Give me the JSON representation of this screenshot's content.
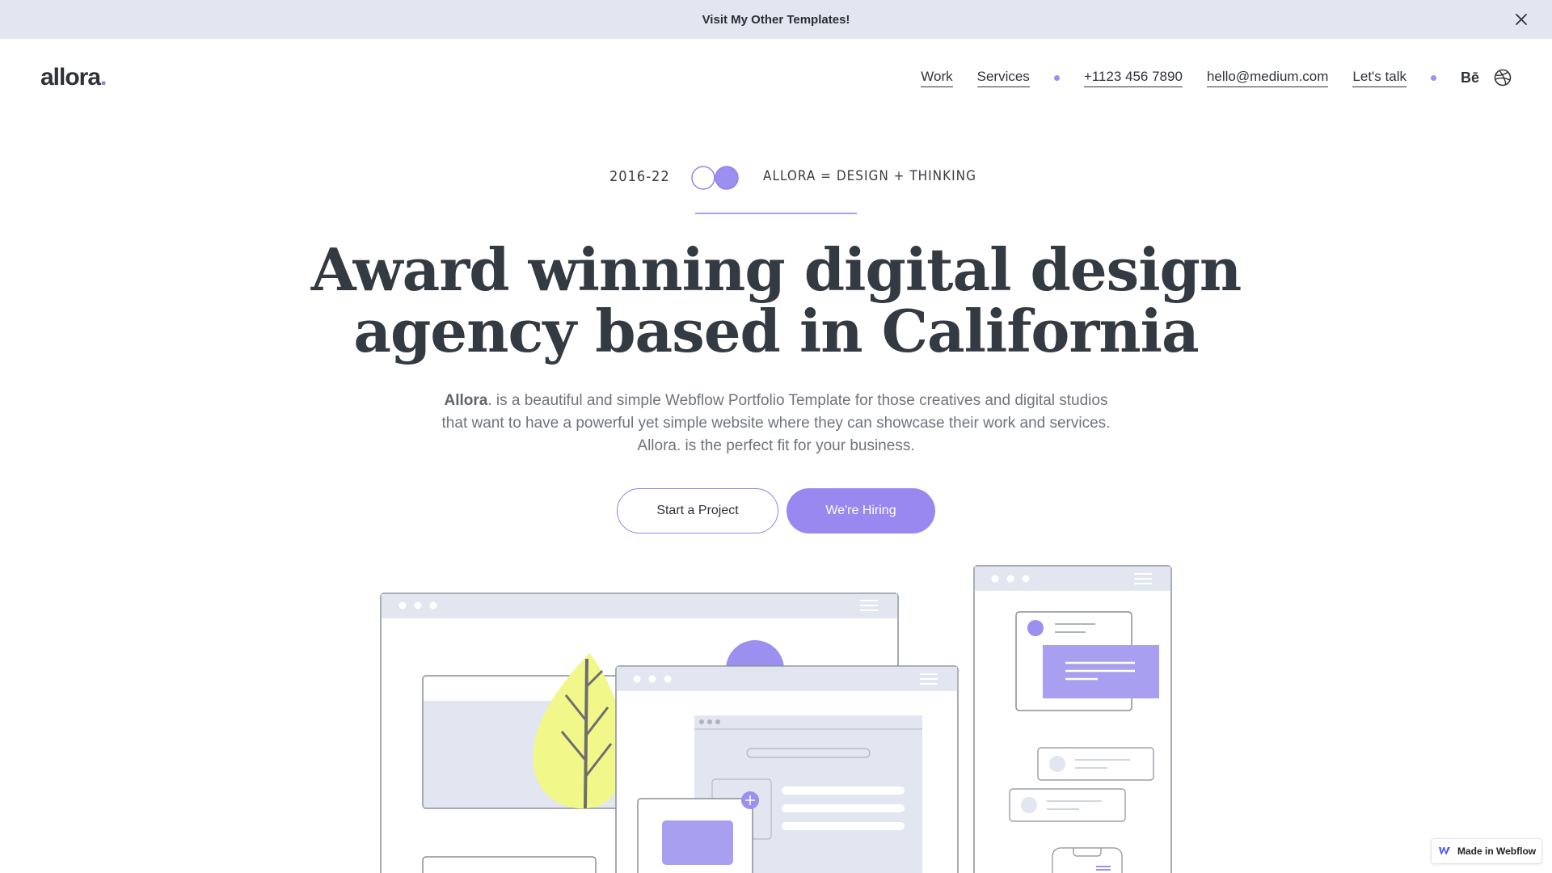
{
  "banner": {
    "text": "Visit My Other Templates!",
    "close_icon": "close-icon"
  },
  "nav": {
    "logo_text": "allora",
    "logo_dot": ".",
    "links": {
      "work": "Work",
      "services": "Services",
      "phone": "+1123 456 7890",
      "email": "hello@medium.com",
      "talk": "Let's talk"
    },
    "behance_label": "Bē",
    "icons": [
      "behance-icon",
      "dribbble-icon"
    ]
  },
  "hero": {
    "year": "2016-22",
    "tagline": "ALLORA = DESIGN + THINKING",
    "headline_line1": "Award winning digital design",
    "headline_line2": "agency based in California",
    "sub_brand": "Allora",
    "sub_text": ". is a beautiful and simple Webflow Portfolio Template for those creatives and digital studios that want to have a powerful yet simple website where they can showcase their work and services. Allora. is the perfect fit for your business.",
    "cta_primary": "Start a Project",
    "cta_secondary": "We're Hiring"
  },
  "badge": {
    "label": "Made in Webflow"
  },
  "colors": {
    "accent": "#9888f0",
    "banner_bg": "#e1e6f1",
    "text_dark": "#343a42",
    "panel": "#e3e7f2",
    "leaf": "#f2f78a"
  }
}
